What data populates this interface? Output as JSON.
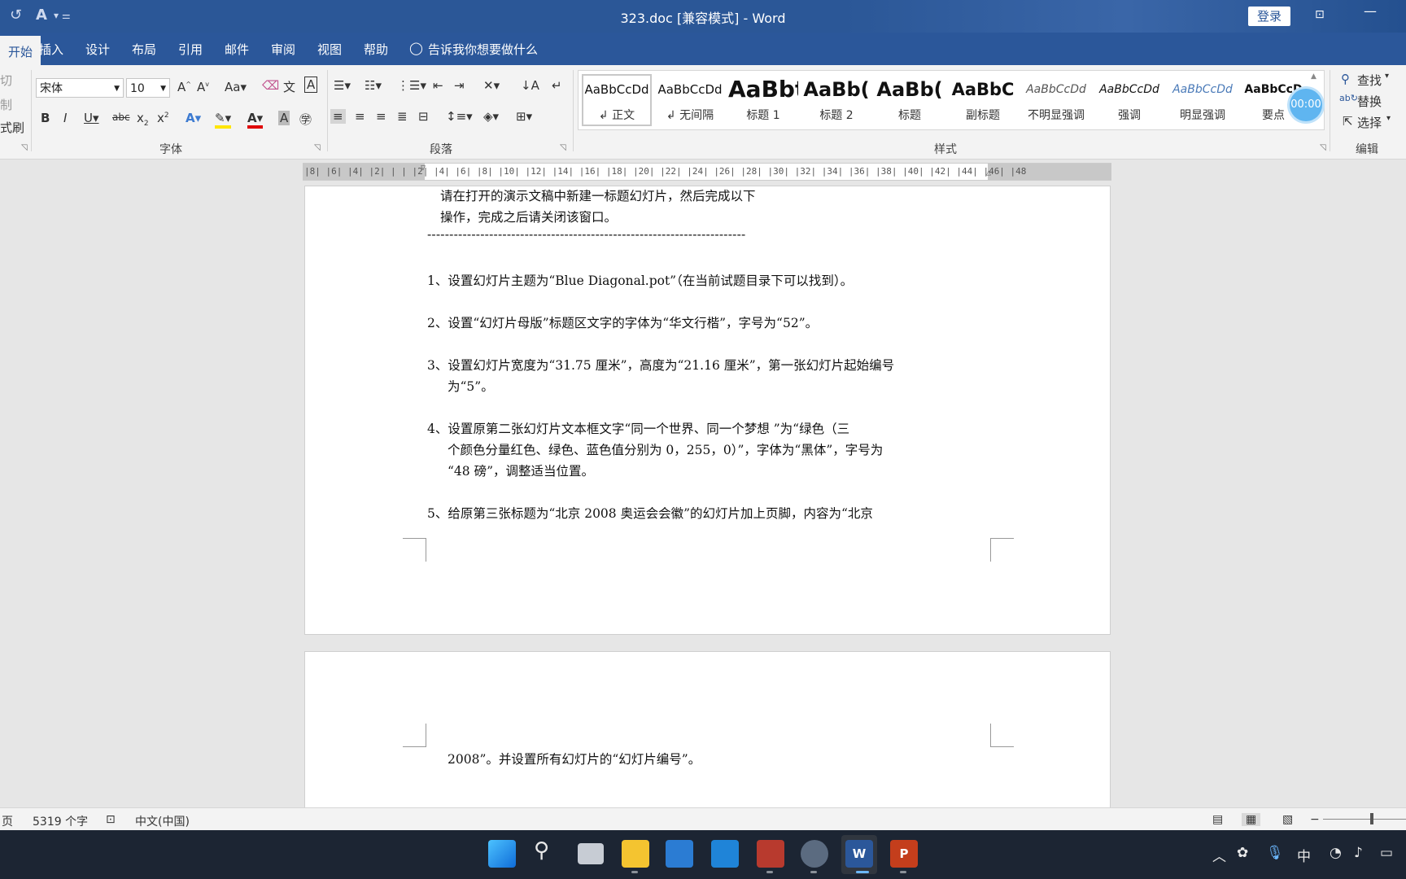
{
  "window": {
    "title": "323.doc [兼容模式]  -  Word",
    "login_label": "登录",
    "qa_autosave": "↺",
    "qa_format": "A",
    "qa_more": "▾ ⚌"
  },
  "menu": {
    "tabs": [
      "开始",
      "插入",
      "设计",
      "布局",
      "引用",
      "邮件",
      "审阅",
      "视图",
      "帮助"
    ],
    "active": "开始",
    "tell_me": "告诉我你想要做什么"
  },
  "clipboard": {
    "cut": "切",
    "copy": "制",
    "format_painter": "式刷"
  },
  "font": {
    "name": "宋体",
    "size": "10",
    "group_label": "字体"
  },
  "paragraph": {
    "group_label": "段落"
  },
  "styles": {
    "group_label": "样式",
    "items": [
      {
        "preview": "AaBbCcDd",
        "name": "↲ 正文"
      },
      {
        "preview": "AaBbCcDd",
        "name": "↲ 无间隔"
      },
      {
        "preview": "AaBbt",
        "name": "标题 1"
      },
      {
        "preview": "AaBb(",
        "name": "标题 2"
      },
      {
        "preview": "AaBb(",
        "name": "标题"
      },
      {
        "preview": "AaBbC",
        "name": "副标题"
      },
      {
        "preview": "AaBbCcDd",
        "name": "不明显强调"
      },
      {
        "preview": "AaBbCcDd",
        "name": "强调"
      },
      {
        "preview": "AaBbCcDd",
        "name": "明显强调"
      },
      {
        "preview": "AaBbCcD",
        "name": "要点"
      }
    ],
    "timer": "00:00"
  },
  "editing": {
    "find": "查找",
    "replace": "替换",
    "select": "选择",
    "group_label": "编辑"
  },
  "ruler": {
    "text": "|8|  |6|  |4|  |2|  |  |  |2|  |4|  |6|  |8|  |10|  |12|  |14|  |16|  |18|  |20|  |22|  |24|  |26|  |28|  |30|  |32|  |34|  |36|  |38|  |40|  |42|  |44|  |46|  |48"
  },
  "document": {
    "intro1": "请在打开的演示文稿中新建一标题幻灯片，然后完成以下",
    "intro2": "操作，完成之后请关闭该窗口。",
    "divider": "------------------------------------------------------------------------",
    "item1": "1、设置幻灯片主题为“Blue Diagonal.pot”（在当前试题目录下可以找到）。",
    "item2": "2、设置“幻灯片母版”标题区文字的字体为“华文行楷”，字号为“52”。",
    "item3a": "3、设置幻灯片宽度为“31.75 厘米”，高度为“21.16 厘米”，第一张幻灯片起始编号",
    "item3b": "为“5”。",
    "item4a": "4、设置原第二张幻灯片文本框文字“同一个世界、同一个梦想 ”为“绿色（三",
    "item4b": "个颜色分量红色、绿色、蓝色值分别为 0，255，0）”，字体为“黑体”，字号为",
    "item4c": "“48 磅”，调整适当位置。",
    "item5a": "5、给原第三张标题为“北京 2008 奥运会会徽”的幻灯片加上页脚，内容为“北京",
    "item5b": "2008”。并设置所有幻灯片的“幻灯片编号”。"
  },
  "status": {
    "page": "页",
    "words": "5319 个字",
    "language": "中文(中国)"
  },
  "taskbar": {
    "ime": "中"
  },
  "colors": {
    "word_blue": "#2b579a",
    "ribbon_bg": "#f3f3f3",
    "taskbar_bg": "#1c2533"
  }
}
